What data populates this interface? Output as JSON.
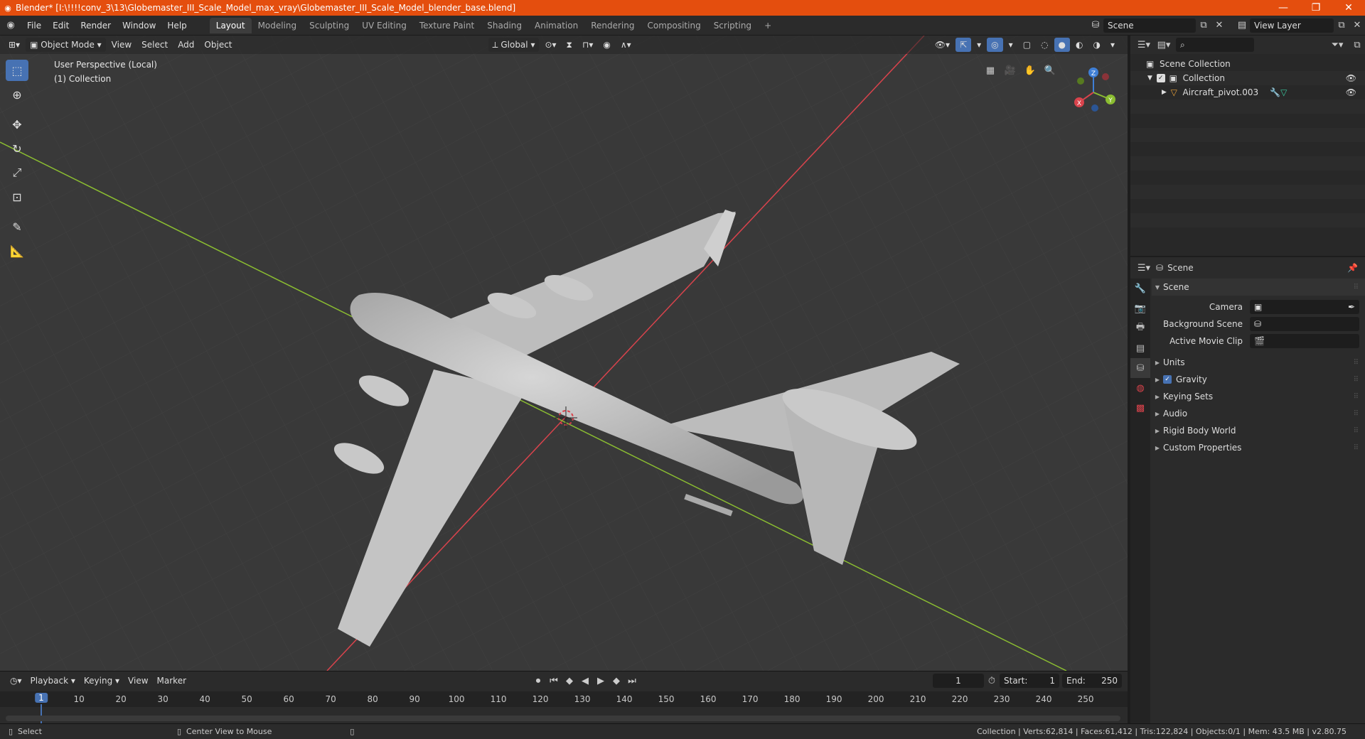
{
  "titlebar": {
    "icon": "blender-logo-icon",
    "title": "Blender* [I:\\!!!!conv_3\\13\\Globemaster_III_Scale_Model_max_vray\\Globemaster_III_Scale_Model_blender_base.blend]",
    "minimize": "—",
    "restore": "❐",
    "close": "✕"
  },
  "menu": [
    "File",
    "Edit",
    "Render",
    "Window",
    "Help"
  ],
  "workspaces": [
    "Layout",
    "Modeling",
    "Sculpting",
    "UV Editing",
    "Texture Paint",
    "Shading",
    "Animation",
    "Rendering",
    "Compositing",
    "Scripting"
  ],
  "add_tab": "+",
  "scene_field": "Scene",
  "view_layer_field": "View Layer",
  "viewport": {
    "mode": "Object Mode",
    "menus": [
      "View",
      "Select",
      "Add",
      "Object"
    ],
    "transform_orientation": "Global",
    "perspective_label": "User Perspective (Local)",
    "collection_label": "(1) Collection"
  },
  "gizmo": {
    "x": "X",
    "y": "Y",
    "z": "Z"
  },
  "timeline": {
    "menus": [
      "Playback",
      "Keying",
      "View",
      "Marker"
    ],
    "current_frame": "1",
    "start_label": "Start:",
    "start": "1",
    "end_label": "End:",
    "end": "250",
    "ticks": [
      "1",
      "10",
      "20",
      "30",
      "40",
      "50",
      "60",
      "70",
      "80",
      "90",
      "100",
      "110",
      "120",
      "130",
      "140",
      "150",
      "160",
      "170",
      "180",
      "190",
      "200",
      "210",
      "220",
      "230",
      "240",
      "250"
    ]
  },
  "statusbar": {
    "select": "Select",
    "center_view": "Center View to Mouse",
    "stats": "Collection | Verts:62,814 | Faces:61,412 | Tris:122,824 | Objects:0/1 | Mem: 43.5 MB | v2.80.75"
  },
  "outliner": {
    "scene_collection": "Scene Collection",
    "collection": "Collection",
    "object": "Aircraft_pivot.003"
  },
  "properties": {
    "header": "Scene",
    "section": "Scene",
    "camera_label": "Camera",
    "background_scene_label": "Background Scene",
    "active_movie_clip_label": "Active Movie Clip",
    "panels": [
      "Units",
      "Gravity",
      "Keying Sets",
      "Audio",
      "Rigid Body World",
      "Custom Properties"
    ]
  },
  "colors": {
    "title_bar": "#e44e0e",
    "accent": "#4772b3",
    "x_axis": "#d9434c",
    "y_axis": "#8bbd31",
    "z_axis": "#3f7fd6"
  }
}
